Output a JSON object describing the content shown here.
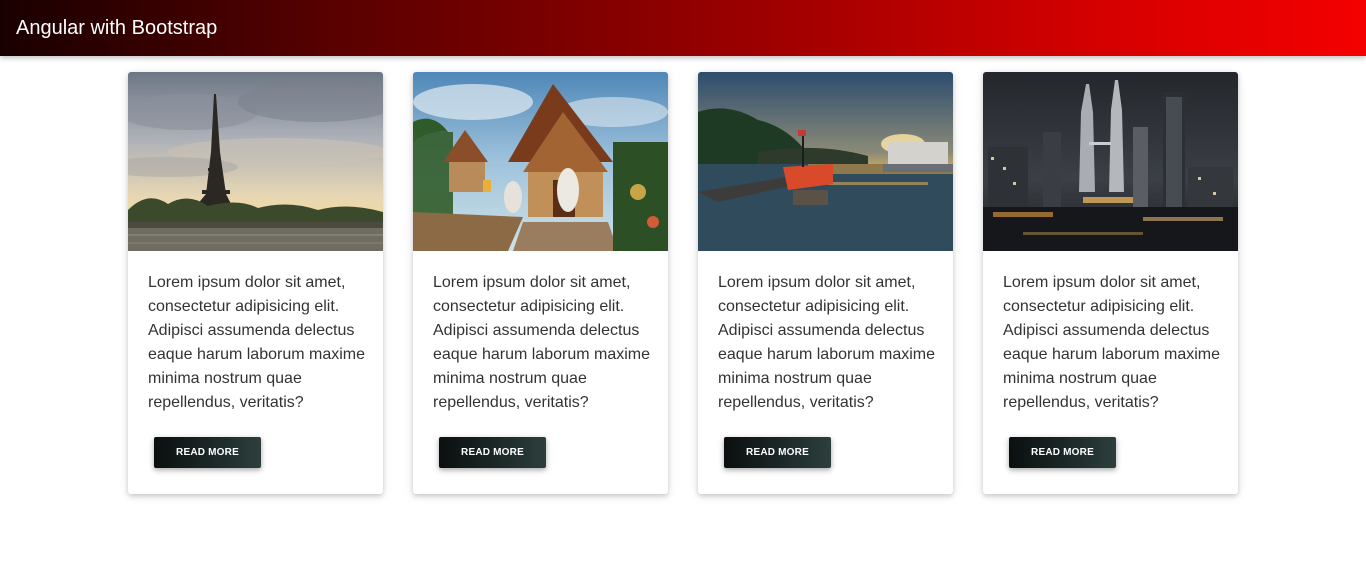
{
  "navbar": {
    "brand": "Angular with Bootstrap"
  },
  "cards": [
    {
      "image_icon": "eiffel-tower-sunset-photo",
      "text": "Lorem ipsum dolor sit amet, consectetur adipisicing elit. Adipisci assumenda delectus eaque harum laborum maxime minima nostrum quae repellendus, veritatis?",
      "button_label": "READ MORE"
    },
    {
      "image_icon": "thai-temple-photo",
      "text": "Lorem ipsum dolor sit amet, consectetur adipisicing elit. Adipisci assumenda delectus eaque harum laborum maxime minima nostrum quae repellendus, veritatis?",
      "button_label": "READ MORE"
    },
    {
      "image_icon": "harbor-boats-sunset-photo",
      "text": "Lorem ipsum dolor sit amet, consectetur adipisicing elit. Adipisci assumenda delectus eaque harum laborum maxime minima nostrum quae repellendus, veritatis?",
      "button_label": "READ MORE"
    },
    {
      "image_icon": "city-skyline-night-photo",
      "text": "Lorem ipsum dolor sit amet, consectetur adipisicing elit. Adipisci assumenda delectus eaque harum laborum maxime minima nostrum quae repellendus, veritatis?",
      "button_label": "READ MORE"
    }
  ]
}
